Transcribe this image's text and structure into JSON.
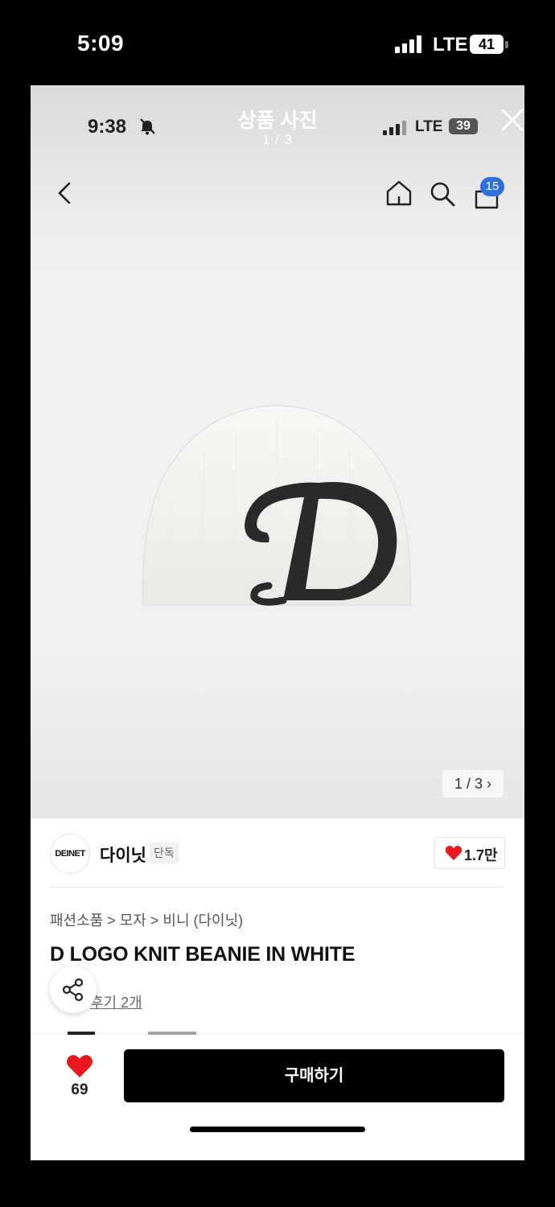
{
  "outer_status": {
    "time": "5:09",
    "network": "LTE",
    "battery": "41"
  },
  "inner_status": {
    "time": "9:38",
    "network": "LTE",
    "battery": "39"
  },
  "viewer": {
    "title": "상품 사진",
    "count": "1 / 3"
  },
  "header": {
    "cart_count": "15"
  },
  "gallery": {
    "page_indicator": "1 / 3 ›",
    "logo_letter": "D"
  },
  "brand": {
    "logo_text": "DEINET",
    "name": "다이닛",
    "badge": "단독",
    "like_count": "1.7만"
  },
  "product": {
    "breadcrumb": "패션소품 > 모자 > 비니 (다이닛)",
    "title": "D LOGO KNIT BEANIE IN WHITE",
    "review_link": "후기 2개"
  },
  "bottom_bar": {
    "wish_count": "69",
    "buy_label": "구매하기"
  },
  "colors": {
    "accent_blue": "#2f6fe0",
    "heart_red": "#e8191e",
    "buy_button": "#000000"
  },
  "icons": [
    "bell-off-icon",
    "close-icon",
    "back-icon",
    "home-icon",
    "search-icon",
    "cart-icon",
    "heart-icon",
    "share-icon"
  ]
}
